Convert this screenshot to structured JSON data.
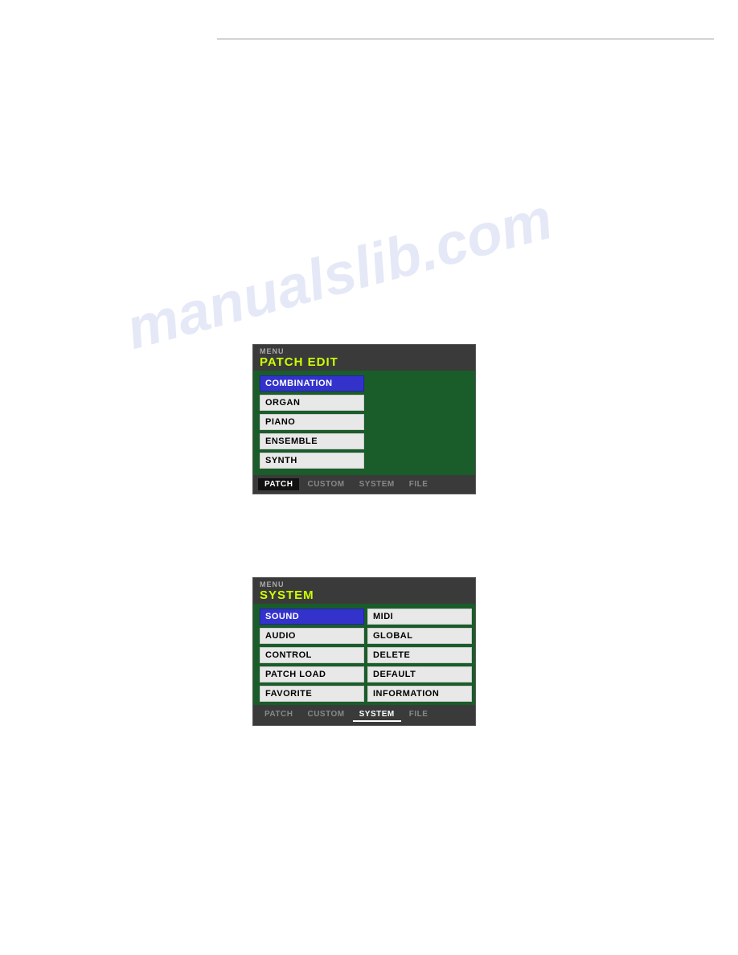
{
  "page": {
    "background_color": "#ffffff",
    "top_line": true
  },
  "watermark": {
    "text": "manualslib.com"
  },
  "screen1": {
    "menu_label": "MENU",
    "title": "PATCH EDIT",
    "items": [
      {
        "label": "COMBINATION",
        "selected": true
      },
      {
        "label": "ORGAN",
        "selected": false
      },
      {
        "label": "PIANO",
        "selected": false
      },
      {
        "label": "ENSEMBLE",
        "selected": false
      },
      {
        "label": "SYNTH",
        "selected": false
      }
    ],
    "tabs": [
      {
        "label": "PATCH",
        "active": true,
        "underline": false
      },
      {
        "label": "CUSTOM",
        "active": false,
        "underline": false
      },
      {
        "label": "SYSTEM",
        "active": false,
        "underline": false
      },
      {
        "label": "FILE",
        "active": false,
        "underline": false
      }
    ]
  },
  "screen2": {
    "menu_label": "MENU",
    "title": "SYSTEM",
    "left_items": [
      {
        "label": "SOUND",
        "selected": true
      },
      {
        "label": "AUDIO",
        "selected": false
      },
      {
        "label": "CONTROL",
        "selected": false
      },
      {
        "label": "PATCH LOAD",
        "selected": false
      },
      {
        "label": "FAVORITE",
        "selected": false
      }
    ],
    "right_items": [
      {
        "label": "MIDI",
        "selected": false
      },
      {
        "label": "GLOBAL",
        "selected": false
      },
      {
        "label": "DELETE",
        "selected": false
      },
      {
        "label": "DEFAULT",
        "selected": false
      },
      {
        "label": "INFORMATION",
        "selected": false
      }
    ],
    "tabs": [
      {
        "label": "PATCH",
        "active": false,
        "underline": false
      },
      {
        "label": "CUSTOM",
        "active": false,
        "underline": false
      },
      {
        "label": "SYSTEM",
        "active": true,
        "underline": true
      },
      {
        "label": "FILE",
        "active": false,
        "underline": false
      }
    ]
  }
}
